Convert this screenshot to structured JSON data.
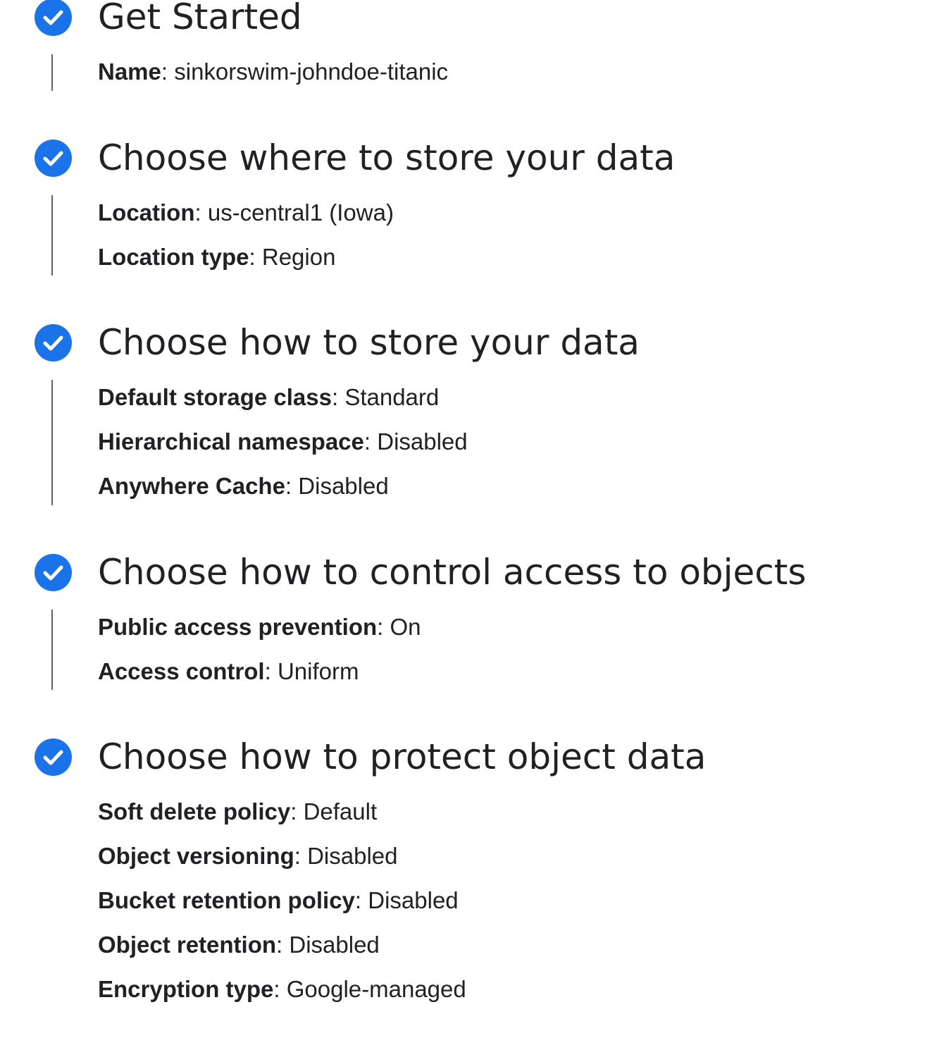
{
  "steps": [
    {
      "title": "Get Started",
      "details": [
        {
          "label": "Name",
          "value": "sinkorswim-johndoe-titanic"
        }
      ]
    },
    {
      "title": "Choose where to store your data",
      "details": [
        {
          "label": "Location",
          "value": "us-central1 (Iowa)"
        },
        {
          "label": "Location type",
          "value": "Region"
        }
      ]
    },
    {
      "title": "Choose how to store your data",
      "details": [
        {
          "label": "Default storage class",
          "value": "Standard"
        },
        {
          "label": "Hierarchical namespace",
          "value": "Disabled"
        },
        {
          "label": "Anywhere Cache",
          "value": "Disabled"
        }
      ]
    },
    {
      "title": "Choose how to control access to objects",
      "details": [
        {
          "label": "Public access prevention",
          "value": "On"
        },
        {
          "label": "Access control",
          "value": "Uniform"
        }
      ]
    },
    {
      "title": "Choose how to protect object data",
      "details": [
        {
          "label": "Soft delete policy",
          "value": "Default"
        },
        {
          "label": "Object versioning",
          "value": "Disabled"
        },
        {
          "label": "Bucket retention policy",
          "value": "Disabled"
        },
        {
          "label": "Object retention",
          "value": "Disabled"
        },
        {
          "label": "Encryption type",
          "value": "Google-managed"
        }
      ]
    }
  ],
  "separator": ": ",
  "icon": "check-circle-icon",
  "colors": {
    "accent": "#1a73e8",
    "text": "#202124",
    "rail": "#5f6368"
  }
}
